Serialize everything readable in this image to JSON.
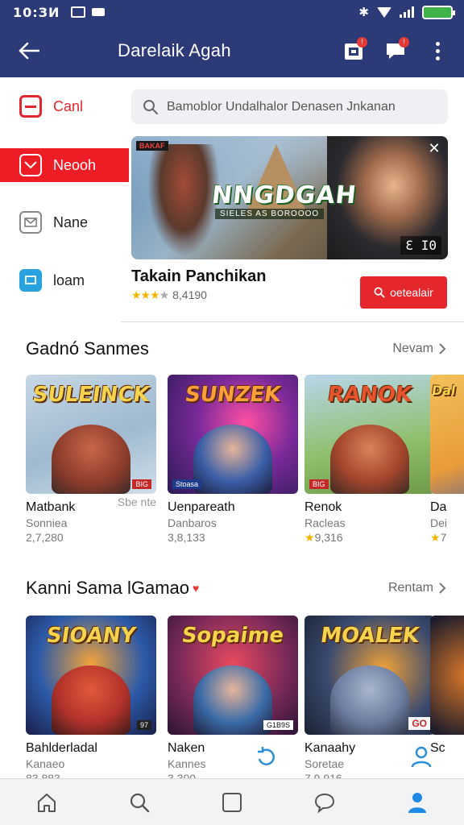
{
  "status_bar": {
    "time": "10:ЗИ",
    "colors": {
      "bg": "#2d3a78"
    }
  },
  "app_bar": {
    "title": "Darelaik Agah",
    "badges": {
      "notifications": "!",
      "messages": "!"
    }
  },
  "side_nav": {
    "items": [
      {
        "label": "Canl",
        "icon": "minus-box-icon"
      },
      {
        "label": "Neooh",
        "icon": "inbox-icon"
      },
      {
        "label": "Nane",
        "icon": "mail-icon"
      },
      {
        "label": "loam",
        "icon": "screen-icon"
      }
    ],
    "active_index": 1,
    "accent": "#ee1c25"
  },
  "search": {
    "placeholder": "Bamoblor Undalhalor Denasen Jnkanan"
  },
  "hero": {
    "tag": "BAKAF",
    "logo": "NNGDGAH",
    "subtitle": "SIELES AS BOROOOO",
    "counter": "Ɛ I0",
    "title": "Takain Panchikan",
    "stars": "★★★",
    "star_half": "★",
    "rating_text": "8,4190",
    "button_label": "oetealair"
  },
  "sections": [
    {
      "title": "Gadnó Sanmes",
      "more": "Nevam",
      "cards": [
        {
          "logo": "SULEINCK",
          "chip": "BIG",
          "title": "Matbank",
          "sub": "Sonniea",
          "meta": "2,7,280",
          "badge": "Sbe nte",
          "colors": {
            "bg": "#9fb9cf",
            "fig": "#8b3b2a"
          }
        },
        {
          "logo": "SUNZEK",
          "chip": "Stoasa",
          "title": "Uenpareath",
          "sub": "Danbaros",
          "meta": "3,8,133",
          "colors": {
            "bg": "#5a2e7a",
            "fig": "#3a5ea8"
          }
        },
        {
          "logo": "RANOK",
          "chip": "BIG",
          "title": "Renok",
          "sub": "Racleas",
          "meta": "9,316",
          "star": "★",
          "colors": {
            "bg": "#8fbf6b",
            "fig": "#a2452c"
          }
        },
        {
          "logo": "Dal",
          "title": "Da",
          "sub": "Dei",
          "meta": "7",
          "star": "★",
          "colors": {
            "bg": "#e89b3a",
            "fig": "#4a5ba0"
          }
        }
      ]
    },
    {
      "title": "Kanni Sama lGamao",
      "more": "Rentam",
      "cards": [
        {
          "logo": "SIOANY",
          "chip": "97",
          "title": "Bahlderladal",
          "sub": "Kanaeo",
          "meta": "83,883",
          "colors": {
            "bg": "#2c5aa8",
            "fig": "#b2322b"
          }
        },
        {
          "logo": "Sopaime",
          "chip": "G1B9S",
          "title": "Naken",
          "sub": "Kannes",
          "meta": "3,300",
          "colors": {
            "bg": "#7c2a5a",
            "fig": "#3b6ba8"
          }
        },
        {
          "logo": "MOALEK",
          "chip": "GO",
          "title": "Kanaahy",
          "sub": "Soretae",
          "meta": "7,9,916",
          "colors": {
            "bg": "#3a4a6e",
            "fig": "#6d7da0"
          }
        },
        {
          "logo": "",
          "title": "Sc",
          "sub": "",
          "meta": "",
          "colors": {
            "bg": "#1d1d2b",
            "fig": "#e07a2a"
          }
        }
      ]
    }
  ],
  "bottom_nav": {
    "items": [
      "home-icon",
      "search-icon",
      "square-icon",
      "chat-icon",
      "profile-icon"
    ],
    "active_index": 4,
    "active_color": "#1e88e5"
  }
}
